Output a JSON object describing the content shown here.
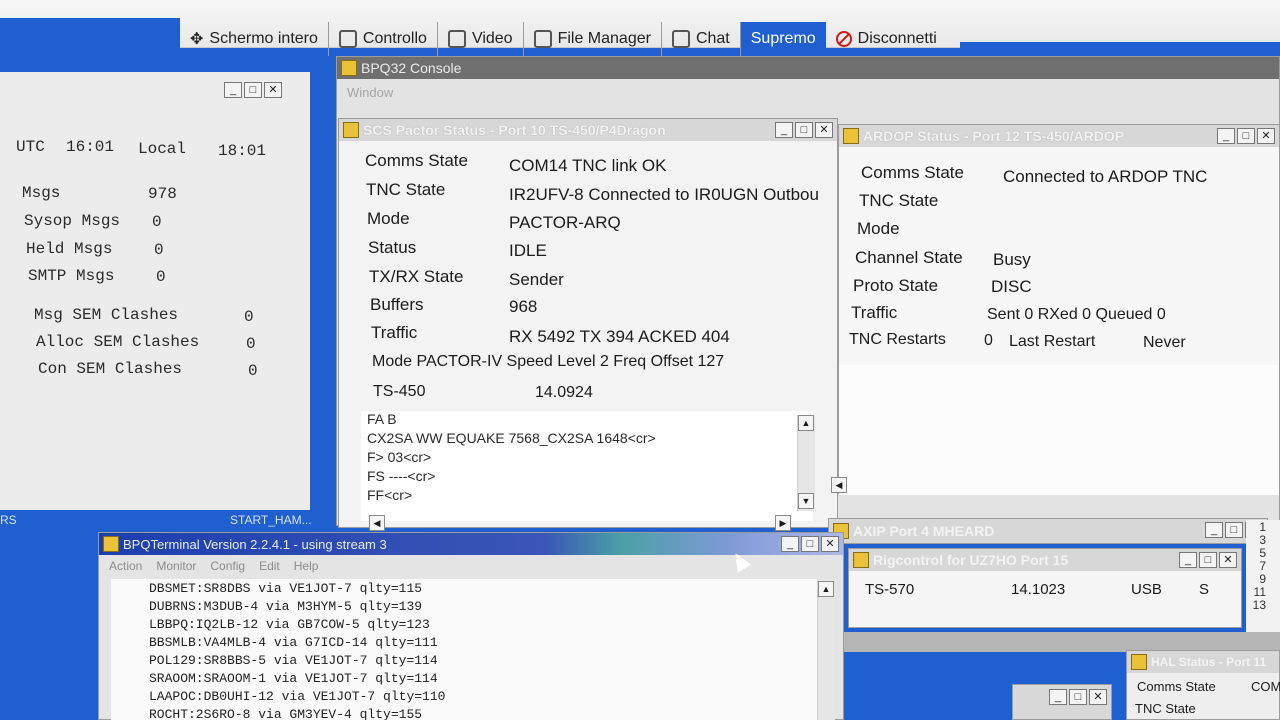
{
  "toolbar": {
    "items": [
      {
        "label": "Schermo intero",
        "icon": "move-arrows-icon"
      },
      {
        "label": "Controllo",
        "icon": "document-icon"
      },
      {
        "label": "Video",
        "icon": "monitor-icon"
      },
      {
        "label": "File Manager",
        "icon": "folders-icon"
      },
      {
        "label": "Chat",
        "icon": "chat-icon"
      },
      {
        "label": "Supremo",
        "icon": ""
      },
      {
        "label": "Disconnetti",
        "icon": "stop-icon"
      }
    ],
    "collapse_glyph": "⌃",
    "accent": "#1f5fcf"
  },
  "bbs": {
    "utc_label": "UTC",
    "utc_time": "16:01",
    "local_label": "Local",
    "local_time": "18:01",
    "stats": [
      {
        "label": "Msgs",
        "value": "978"
      },
      {
        "label": "Sysop Msgs",
        "value": "0"
      },
      {
        "label": "Held Msgs",
        "value": "0"
      },
      {
        "label": "SMTP Msgs",
        "value": "0"
      }
    ],
    "clashes": [
      {
        "label": "Msg SEM Clashes",
        "value": "0"
      },
      {
        "label": "Alloc SEM Clashes",
        "value": "0"
      },
      {
        "label": "Con SEM Clashes",
        "value": "0"
      }
    ],
    "taskbar_left": "RS",
    "taskbar_right": "START_HAM..."
  },
  "console": {
    "title": "BPQ32 Console",
    "menu": "Window"
  },
  "scs": {
    "title": "SCS Pactor Status - Port 10  TS-450/P4Dragon",
    "fields": [
      {
        "label": "Comms State",
        "value": "COM14 TNC link OK"
      },
      {
        "label": "TNC State",
        "value": "IR2UFV-8 Connected to IR0UGN Outbou"
      },
      {
        "label": "Mode",
        "value": "PACTOR-ARQ"
      },
      {
        "label": "Status",
        "value": "IDLE"
      },
      {
        "label": "TX/RX State",
        "value": "Sender"
      },
      {
        "label": "Buffers",
        "value": "968"
      },
      {
        "label": "Traffic",
        "value": "RX 5492 TX 394 ACKED 404"
      }
    ],
    "mode_line": "Mode PACTOR-IV Speed Level 2 Freq Offset 127",
    "radio": "TS-450",
    "freq": "14.0924",
    "log": [
      "FA B",
      "CX2SA WW EQUAKE 7568_CX2SA 1648<cr>",
      "F> 03<cr>",
      "FS ----<cr>",
      "FF<cr>"
    ]
  },
  "ardop": {
    "title": "ARDOP Status - Port 12  TS-450/ARDOP",
    "fields": [
      {
        "label": "Comms State",
        "value": "Connected to ARDOP TNC"
      },
      {
        "label": "TNC State",
        "value": ""
      },
      {
        "label": "Mode",
        "value": ""
      },
      {
        "label": "Channel State",
        "value": "Busy"
      },
      {
        "label": "Proto State",
        "value": "DISC"
      },
      {
        "label": "Traffic",
        "value": "Sent 0 RXed 0 Queued 0"
      }
    ],
    "restarts_label": "TNC Restarts",
    "restarts_value": "0",
    "last_restart_label": "Last Restart",
    "last_restart_value": "Never"
  },
  "terminal": {
    "title": "BPQTerminal Version 2.2.4.1 - using stream 3",
    "menu": [
      "Action",
      "Monitor",
      "Config",
      "Edit",
      "Help"
    ],
    "lines": [
      "DBSMET:SR8DBS via VE1JOT-7 qlty=115",
      "DUBRNS:M3DUB-4 via M3HYM-5 qlty=139",
      "LBBPQ:IQ2LB-12 via GB7COW-5 qlty=123",
      "BBSMLB:VA4MLB-4 via G7ICD-14 qlty=111",
      "POL129:SR8BBS-5 via VE1JOT-7 qlty=114",
      "SRAOOM:SRAOOM-1 via VE1JOT-7 qlty=114",
      "LAAPOC:DB0UHI-12 via VE1JOT-7 qlty=110",
      "ROCHT:2S6RO-8 via GM3YEV-4 qlty=155"
    ]
  },
  "axip": {
    "title": "AXIP Port 4 MHEARD"
  },
  "rig": {
    "title": "Rigcontrol for UZ7HO Port 15",
    "radio": "TS-570",
    "freq": "14.1023",
    "mode": "USB",
    "status": "S"
  },
  "hal": {
    "title": "HAL Status - Port 11",
    "fields": [
      {
        "label": "Comms State",
        "value": "COM"
      },
      {
        "label": "TNC State",
        "value": ""
      }
    ]
  },
  "right_numbers": [
    "1",
    "3",
    "5",
    "7",
    "9",
    "11",
    "13"
  ],
  "right_numbers_prefix": [
    "",
    "",
    "",
    "7-",
    "",
    "",
    ""
  ]
}
